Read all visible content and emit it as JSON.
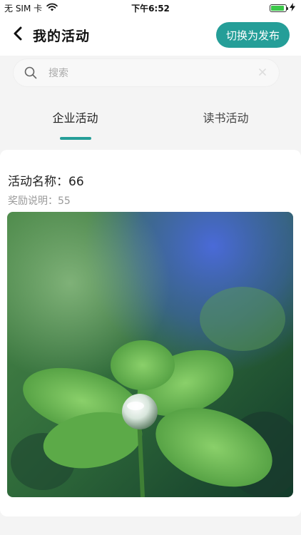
{
  "status_bar": {
    "carrier": "无 SIM 卡",
    "time": "下午6:52",
    "battery_level": 0.9
  },
  "navbar": {
    "title": "我的活动",
    "switch_button": "切换为发布"
  },
  "search": {
    "placeholder": "搜索",
    "value": ""
  },
  "tabs": [
    {
      "label": "企业活动",
      "active": true
    },
    {
      "label": "读书活动",
      "active": false
    }
  ],
  "activity": {
    "name": "活动名称：66",
    "reward": "奖励说明：55",
    "image": "four-leaf-clover-water-drop-photo"
  },
  "colors": {
    "accent": "#259e98",
    "background": "#f4f4f4",
    "card": "#ffffff"
  }
}
